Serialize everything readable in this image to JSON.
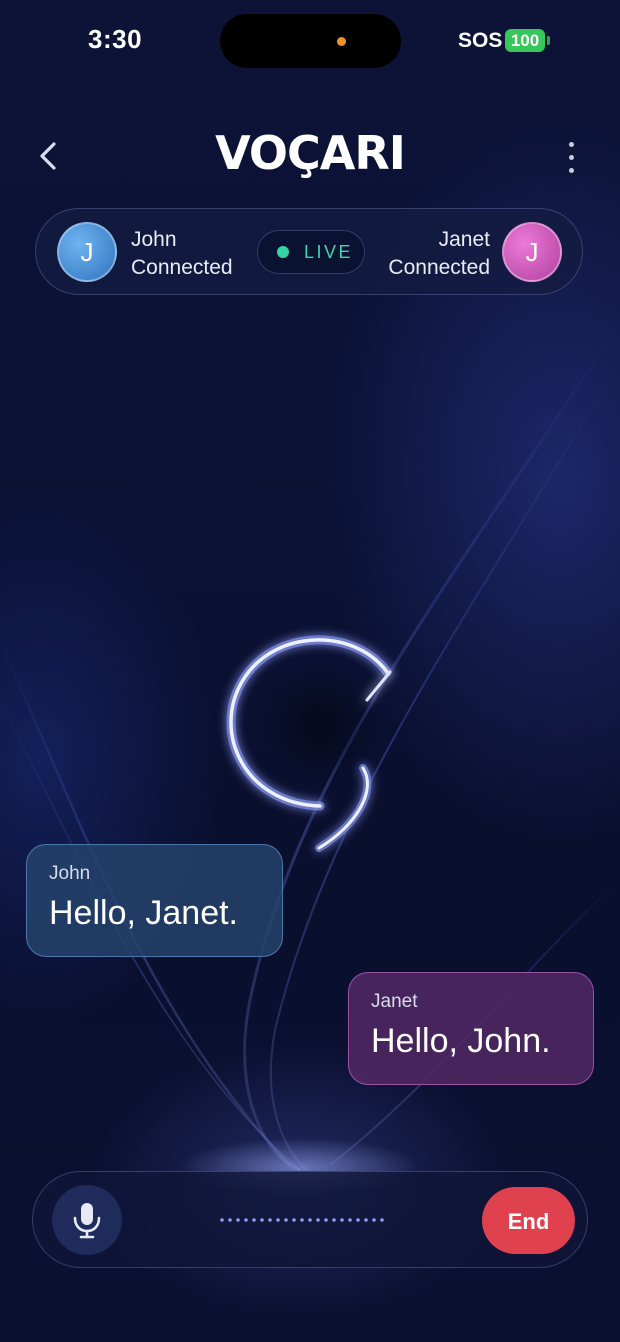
{
  "status_bar": {
    "time": "3:30",
    "carrier": "SOS",
    "battery": "100"
  },
  "header": {
    "logo": "VOÇARI",
    "back_icon": "chevron-left-icon",
    "menu_icon": "more-vertical-icon"
  },
  "participants": {
    "left": {
      "initial": "J",
      "name": "John",
      "status": "Connected",
      "color": "#3f86d4"
    },
    "right": {
      "initial": "J",
      "name": "Janet",
      "status": "Connected",
      "color": "#d056bd"
    },
    "live_label": "LIVE",
    "live_color": "#36d3a6"
  },
  "messages": [
    {
      "sender": "John",
      "text": "Hello, Janet."
    },
    {
      "sender": "Janet",
      "text": "Hello, John."
    }
  ],
  "controls": {
    "mic_icon": "microphone-icon",
    "end_label": "End",
    "end_color": "#e0414f"
  }
}
